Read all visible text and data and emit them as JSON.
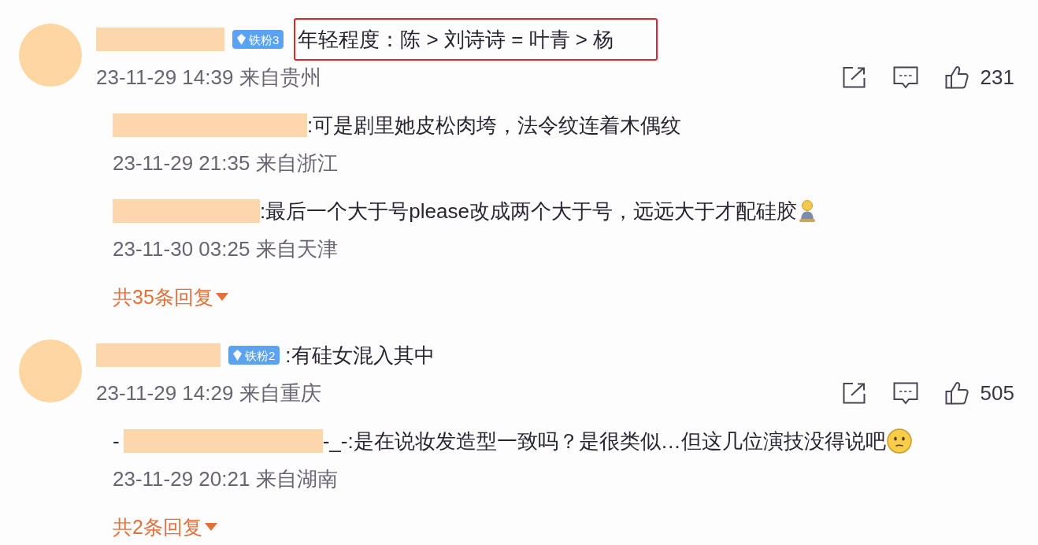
{
  "comments": [
    {
      "badge": "铁粉3",
      "text": "年轻程度：陈 > 刘诗诗 = 叶青 > 杨",
      "highlighted": true,
      "meta": "23-11-29 14:39 来自贵州",
      "likes": "231",
      "replies": [
        {
          "kind": "plain",
          "text": ":可是剧里她皮松肉垮，法令纹连着木偶纹",
          "meta": "23-11-29 21:35 来自浙江"
        },
        {
          "kind": "figure_emoji",
          "text": ":最后一个大于号please改成两个大于号，远远大于才配硅胶",
          "meta": "23-11-30 03:25 来自天津"
        }
      ],
      "more_replies": "共35条回复"
    },
    {
      "badge": "铁粉2",
      "text": ":有硅女混入其中",
      "highlighted": false,
      "meta": "23-11-29 14:29 来自重庆",
      "likes": "505",
      "replies": [
        {
          "kind": "face_emoji",
          "name_start": "-",
          "name_end": "-_-",
          "text": ":是在说妆发造型一致吗？是很类似…但这几位演技没得说吧",
          "meta": "23-11-29 20:21 来自湖南"
        }
      ],
      "more_replies": "共2条回复"
    }
  ]
}
